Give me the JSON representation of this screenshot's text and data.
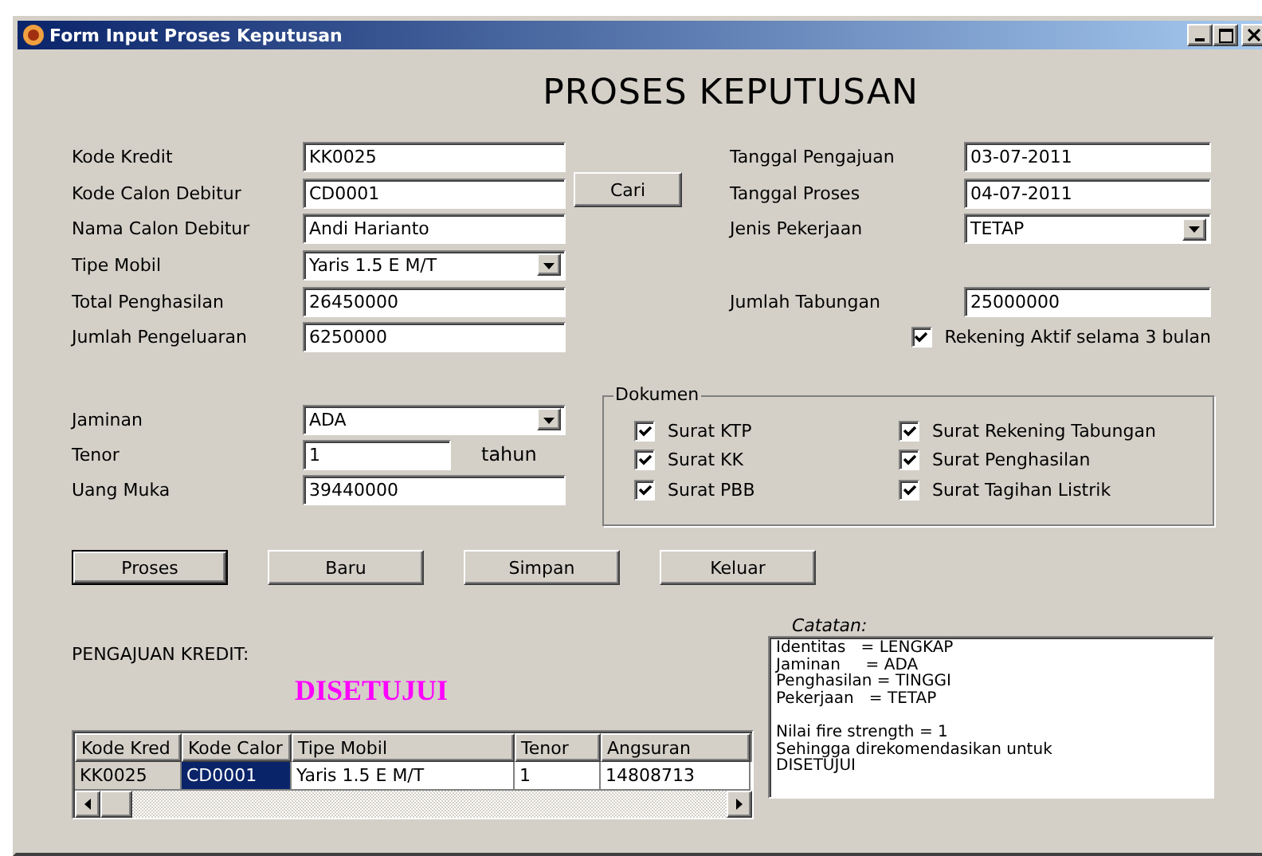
{
  "window": {
    "title": "Form Input Proses Keputusan"
  },
  "heading": "PROSES KEPUTUSAN",
  "left_fields": [
    {
      "label": "Kode Kredit",
      "value": "KK0025",
      "kind": "text"
    },
    {
      "label": "Kode Calon Debitur",
      "value": "CD0001",
      "kind": "text"
    },
    {
      "label": "Nama Calon Debitur",
      "value": "Andi Harianto",
      "kind": "text"
    },
    {
      "label": "Tipe Mobil",
      "value": "Yaris 1.5 E M/T",
      "kind": "combo"
    },
    {
      "label": "Total Penghasilan",
      "value": "26450000",
      "kind": "text"
    },
    {
      "label": "Jumlah Pengeluaran",
      "value": "6250000",
      "kind": "text"
    }
  ],
  "search_button": {
    "label": "Cari"
  },
  "right_fields": [
    {
      "label": "Tanggal Pengajuan",
      "value": "03-07-2011",
      "kind": "text"
    },
    {
      "label": "Tanggal Proses",
      "value": "04-07-2011",
      "kind": "text"
    },
    {
      "label": "Jenis Pekerjaan",
      "value": "TETAP",
      "kind": "combo"
    },
    {
      "label": "Jumlah Tabungan",
      "value": "25000000",
      "kind": "text"
    }
  ],
  "rekening_aktif": {
    "label": "Rekening Aktif selama 3 bulan",
    "checked": true
  },
  "lower_fields": [
    {
      "label": "Jaminan",
      "value": "ADA",
      "kind": "combo"
    },
    {
      "label": "Tenor",
      "value": "1",
      "kind": "text",
      "unit": "tahun"
    },
    {
      "label": "Uang Muka",
      "value": "39440000",
      "kind": "text"
    }
  ],
  "dokumen": {
    "title": "Dokumen",
    "items": [
      {
        "label": "Surat KTP",
        "checked": true
      },
      {
        "label": "Surat Rekening Tabungan",
        "checked": true
      },
      {
        "label": "Surat KK",
        "checked": true
      },
      {
        "label": "Surat Penghasilan",
        "checked": true
      },
      {
        "label": "Surat PBB",
        "checked": true
      },
      {
        "label": "Surat Tagihan Listrik",
        "checked": true
      }
    ]
  },
  "buttons": [
    {
      "label": "Proses",
      "focused": true
    },
    {
      "label": "Baru",
      "focused": false
    },
    {
      "label": "Simpan",
      "focused": false
    },
    {
      "label": "Keluar",
      "focused": false
    }
  ],
  "result": {
    "label": "PENGAJUAN KREDIT:",
    "status": "DISETUJUI"
  },
  "table": {
    "columns": [
      "Kode Kred",
      "Kode Calor",
      "Tipe Mobil",
      "Tenor",
      "Angsuran"
    ],
    "rows": [
      {
        "cells": [
          {
            "text": "KK0025",
            "selected": false
          },
          {
            "text": "CD0001",
            "selected": true
          },
          {
            "text": "Yaris 1.5 E M/T",
            "selected": false
          },
          {
            "text": "1",
            "selected": false
          },
          {
            "text": "14808713",
            "selected": false
          }
        ]
      }
    ]
  },
  "notes": {
    "label": "Catatan:",
    "paragraphs": [
      [
        "Identitas   = LENGKAP",
        "Jaminan     = ADA",
        "Penghasilan = TINGGI",
        "Pekerjaan   = TETAP"
      ],
      [
        "Nilai fire strength = 1",
        "Sehingga direkomendasikan untuk",
        "DISETUJUI"
      ]
    ]
  }
}
